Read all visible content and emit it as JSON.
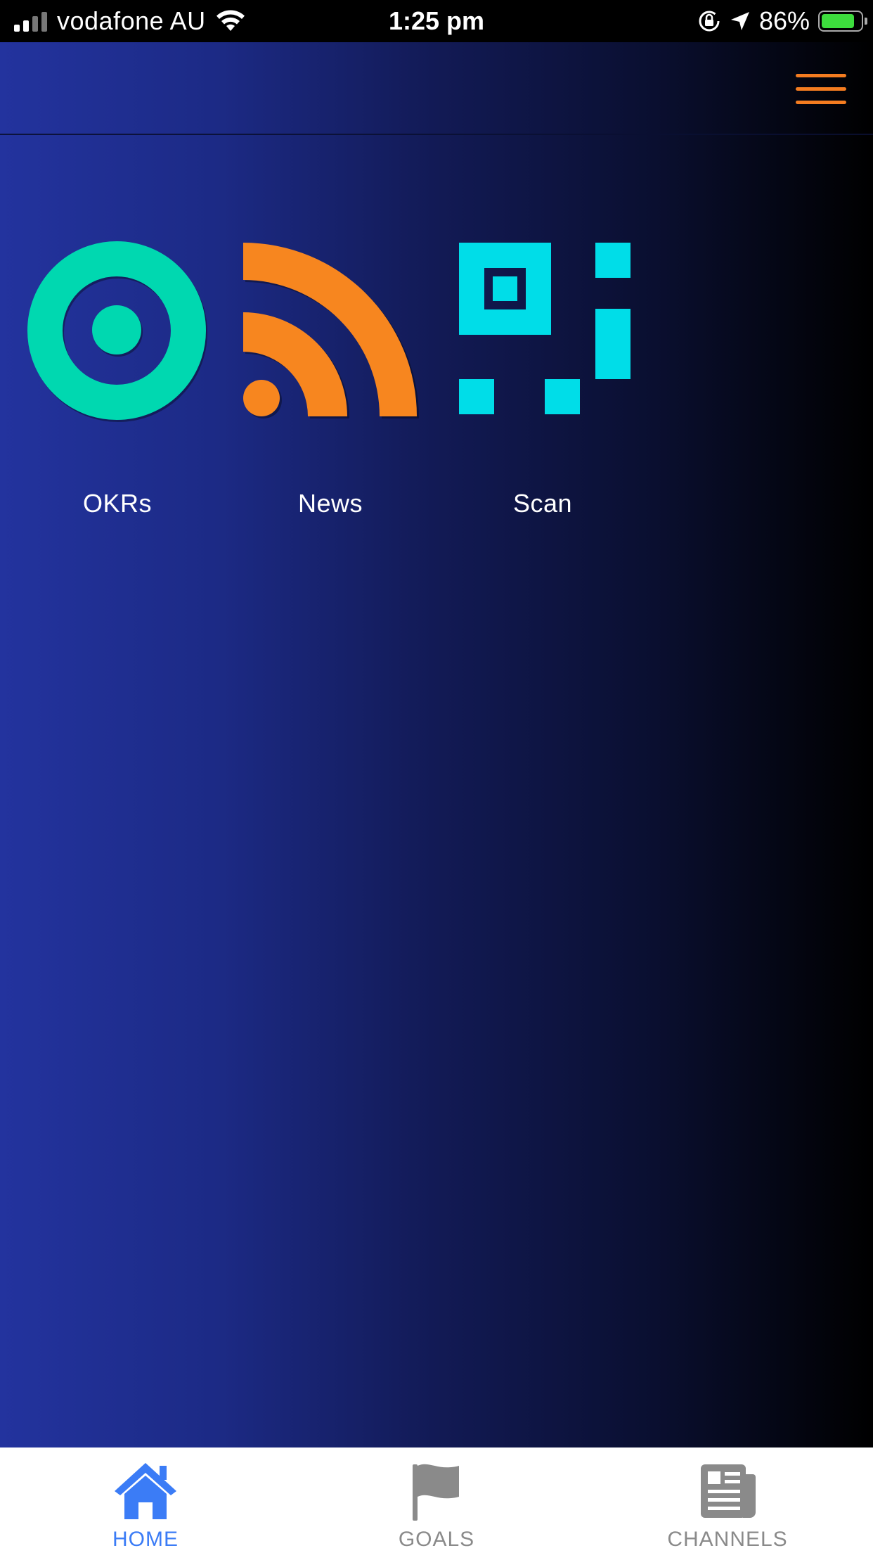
{
  "status_bar": {
    "carrier": "vodafone AU",
    "time": "1:25 pm",
    "battery": "86%",
    "battery_level": 0.86
  },
  "header": {
    "menu_icon": "hamburger-menu-icon",
    "menu_color": "#f47c20"
  },
  "tiles": [
    {
      "label": "OKRs",
      "icon": "target-icon",
      "color": "#00d8b0"
    },
    {
      "label": "News",
      "icon": "rss-feed-icon",
      "color": "#f7861f"
    },
    {
      "label": "Scan",
      "icon": "qr-code-icon",
      "color": "#00dde8"
    }
  ],
  "tab_bar": {
    "active_color": "#3b7cf6",
    "inactive_color": "#8a8a8a",
    "tabs": [
      {
        "label": "HOME",
        "icon": "home-icon",
        "active": true
      },
      {
        "label": "GOALS",
        "icon": "flag-icon",
        "active": false
      },
      {
        "label": "CHANNELS",
        "icon": "newspaper-icon",
        "active": false
      }
    ]
  }
}
